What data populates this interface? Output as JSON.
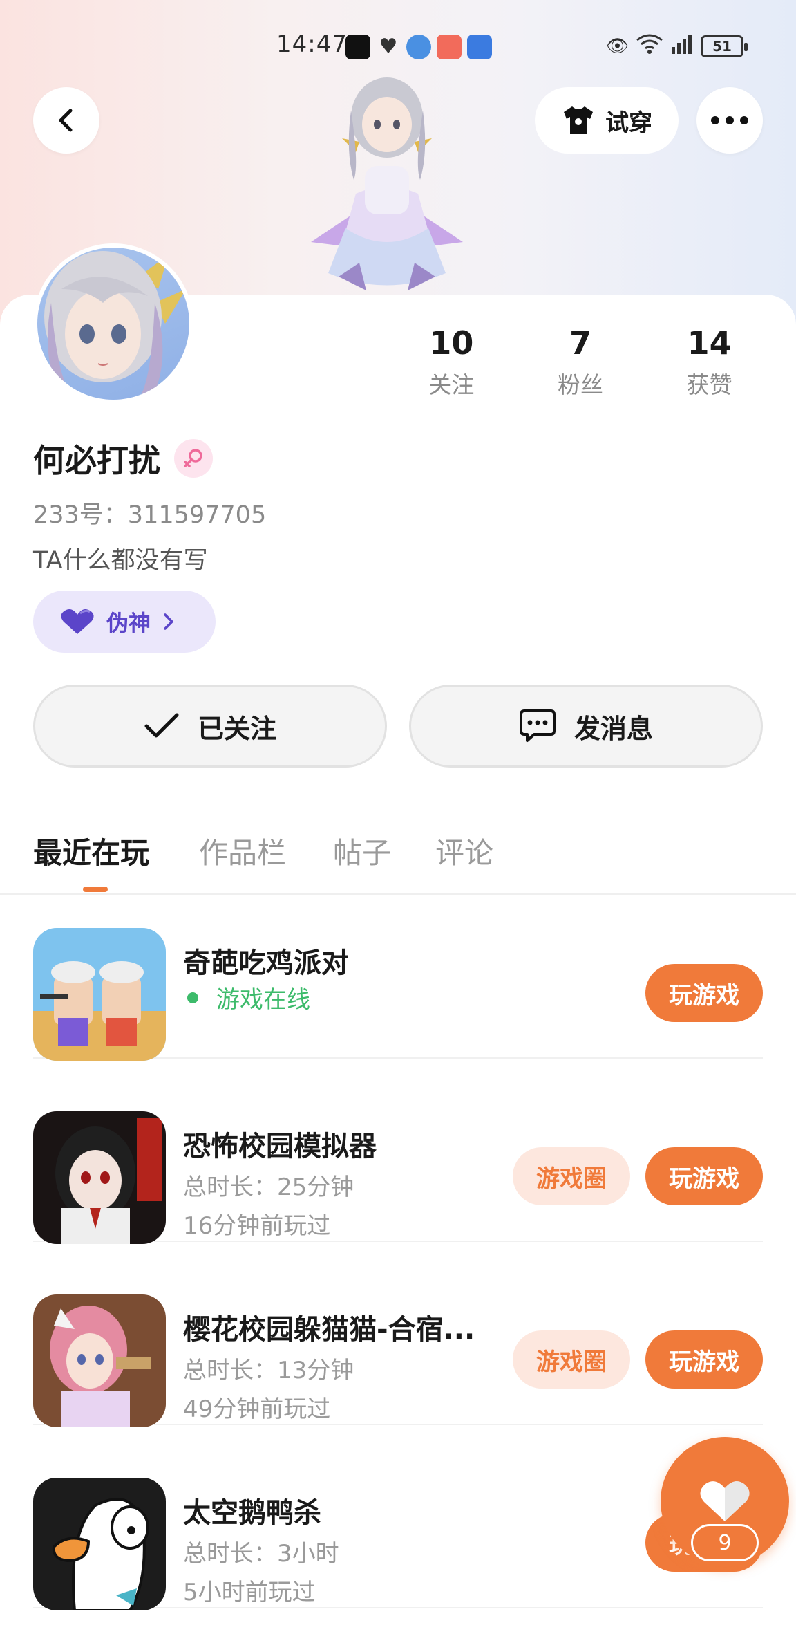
{
  "status_bar": {
    "time": "14:47",
    "battery": "51"
  },
  "header": {
    "try_on_label": "试穿"
  },
  "profile": {
    "username": "何必打扰",
    "account_id": "233号：311597705",
    "bio": "TA什么都没有写",
    "tag": "伪神",
    "stats": [
      {
        "value": "10",
        "label": "关注"
      },
      {
        "value": "7",
        "label": "粉丝"
      },
      {
        "value": "14",
        "label": "获赞"
      }
    ]
  },
  "actions": {
    "follow_label": "已关注",
    "message_label": "发消息"
  },
  "tabs": [
    {
      "label": "最近在玩",
      "active": true
    },
    {
      "label": "作品栏",
      "active": false
    },
    {
      "label": "帖子",
      "active": false
    },
    {
      "label": "评论",
      "active": false
    }
  ],
  "games": [
    {
      "title": "奇葩吃鸡派对",
      "status": "游戏在线",
      "play_label": "玩游戏"
    },
    {
      "title": "恐怖校园模拟器",
      "duration": "总时长：25分钟",
      "last_played": "16分钟前玩过",
      "circle_label": "游戏圈",
      "play_label": "玩游戏"
    },
    {
      "title": "樱花校园躲猫猫-合宿...",
      "duration": "总时长：13分钟",
      "last_played": "49分钟前玩过",
      "circle_label": "游戏圈",
      "play_label": "玩游戏"
    },
    {
      "title": "太空鹅鸭杀",
      "duration": "总时长：3小时",
      "last_played": "5小时前玩过",
      "play_label": "玩游戏"
    }
  ],
  "fab": {
    "count": "9"
  },
  "colors": {
    "accent": "#f07a3a",
    "online": "#3dbb6b",
    "tag_bg": "#ebe7fb",
    "tag_text": "#5b45c9"
  }
}
